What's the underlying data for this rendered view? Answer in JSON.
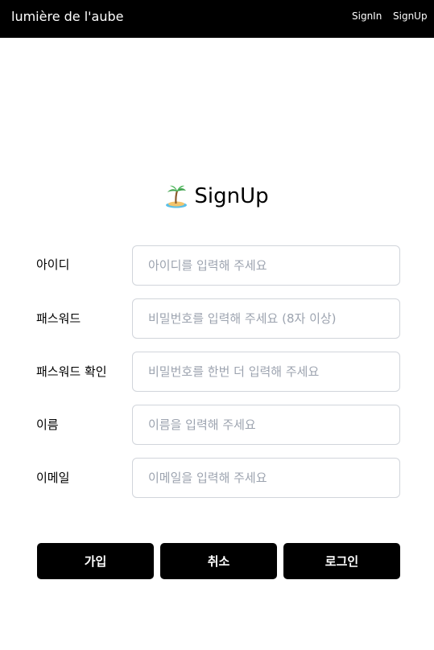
{
  "header": {
    "brand": "lumière de l'aube",
    "nav": {
      "signin": "SignIn",
      "signup": "SignUp"
    }
  },
  "form": {
    "title": "SignUp",
    "title_icon": "desert-island-icon",
    "fields": [
      {
        "label": "아이디",
        "placeholder": "아이디를 입력해 주세요",
        "value": ""
      },
      {
        "label": "패스워드",
        "placeholder": "비밀번호를 입력해 주세요 (8자 이상)",
        "value": ""
      },
      {
        "label": "패스워드 확인",
        "placeholder": "비밀번호를 한번 더 입력해 주세요",
        "value": ""
      },
      {
        "label": "이름",
        "placeholder": "이름을 입력해 주세요",
        "value": ""
      },
      {
        "label": "이메일",
        "placeholder": "이메일을 입력해 주세요",
        "value": ""
      }
    ]
  },
  "buttons": {
    "join": "가입",
    "cancel": "취소",
    "login": "로그인"
  },
  "colors": {
    "header_bg": "#000000",
    "button_bg": "#000000",
    "input_border": "#d1d5db",
    "placeholder": "#9ca3af"
  }
}
